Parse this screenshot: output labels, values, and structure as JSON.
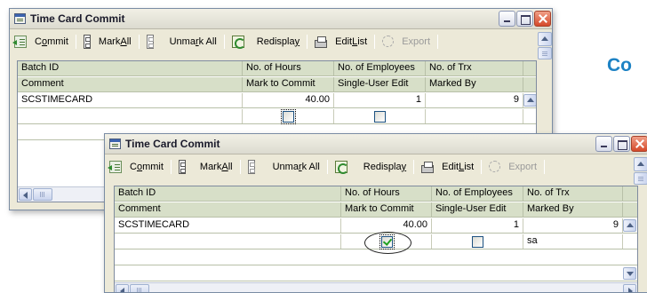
{
  "background": {
    "heading_fragment": "Co"
  },
  "windows": [
    {
      "title": "Time Card Commit",
      "toolbar": {
        "commit": {
          "pre": "C",
          "u": "o",
          "post": "mmit"
        },
        "mark_all": {
          "pre": "Mark ",
          "u": "A",
          "post": "ll"
        },
        "unmark_all": {
          "pre": "Unma",
          "u": "r",
          "post": "k All"
        },
        "redisplay": {
          "pre": "Redispla",
          "u": "y",
          "post": ""
        },
        "edit_list": {
          "pre": "Edit ",
          "u": "L",
          "post": "ist"
        },
        "export": "Export"
      },
      "grid": {
        "headers_row1": [
          "Batch ID",
          "No. of Hours",
          "No. of Employees",
          "No. of Trx"
        ],
        "headers_row2": [
          "Comment",
          "Mark to Commit",
          "Single-User Edit",
          "Marked By"
        ],
        "row1": {
          "batch_id": "SCSTIMECARD",
          "hours": "40.00",
          "employees": "1",
          "trx": "9"
        },
        "row2": {
          "mark_to_commit": false,
          "single_user_edit": false,
          "marked_by": ""
        }
      }
    },
    {
      "title": "Time Card Commit",
      "toolbar": {
        "commit": {
          "pre": "C",
          "u": "o",
          "post": "mmit"
        },
        "mark_all": {
          "pre": "Mark ",
          "u": "A",
          "post": "ll"
        },
        "unmark_all": {
          "pre": "Unma",
          "u": "r",
          "post": "k All"
        },
        "redisplay": {
          "pre": "Redispla",
          "u": "y",
          "post": ""
        },
        "edit_list": {
          "pre": "Edit ",
          "u": "L",
          "post": "ist"
        },
        "export": "Export"
      },
      "grid": {
        "headers_row1": [
          "Batch ID",
          "No. of Hours",
          "No. of Employees",
          "No. of Trx"
        ],
        "headers_row2": [
          "Comment",
          "Mark to Commit",
          "Single-User Edit",
          "Marked By"
        ],
        "row1": {
          "batch_id": "SCSTIMECARD",
          "hours": "40.00",
          "employees": "1",
          "trx": "9"
        },
        "row2": {
          "mark_to_commit": true,
          "single_user_edit": false,
          "marked_by": "sa"
        }
      }
    }
  ],
  "colors": {
    "grid_header": "#d7dfc8",
    "window_body": "#ece9d8",
    "heading_blue": "#1d82c4",
    "close_red": "#d5492a",
    "check_green": "#21a121"
  }
}
